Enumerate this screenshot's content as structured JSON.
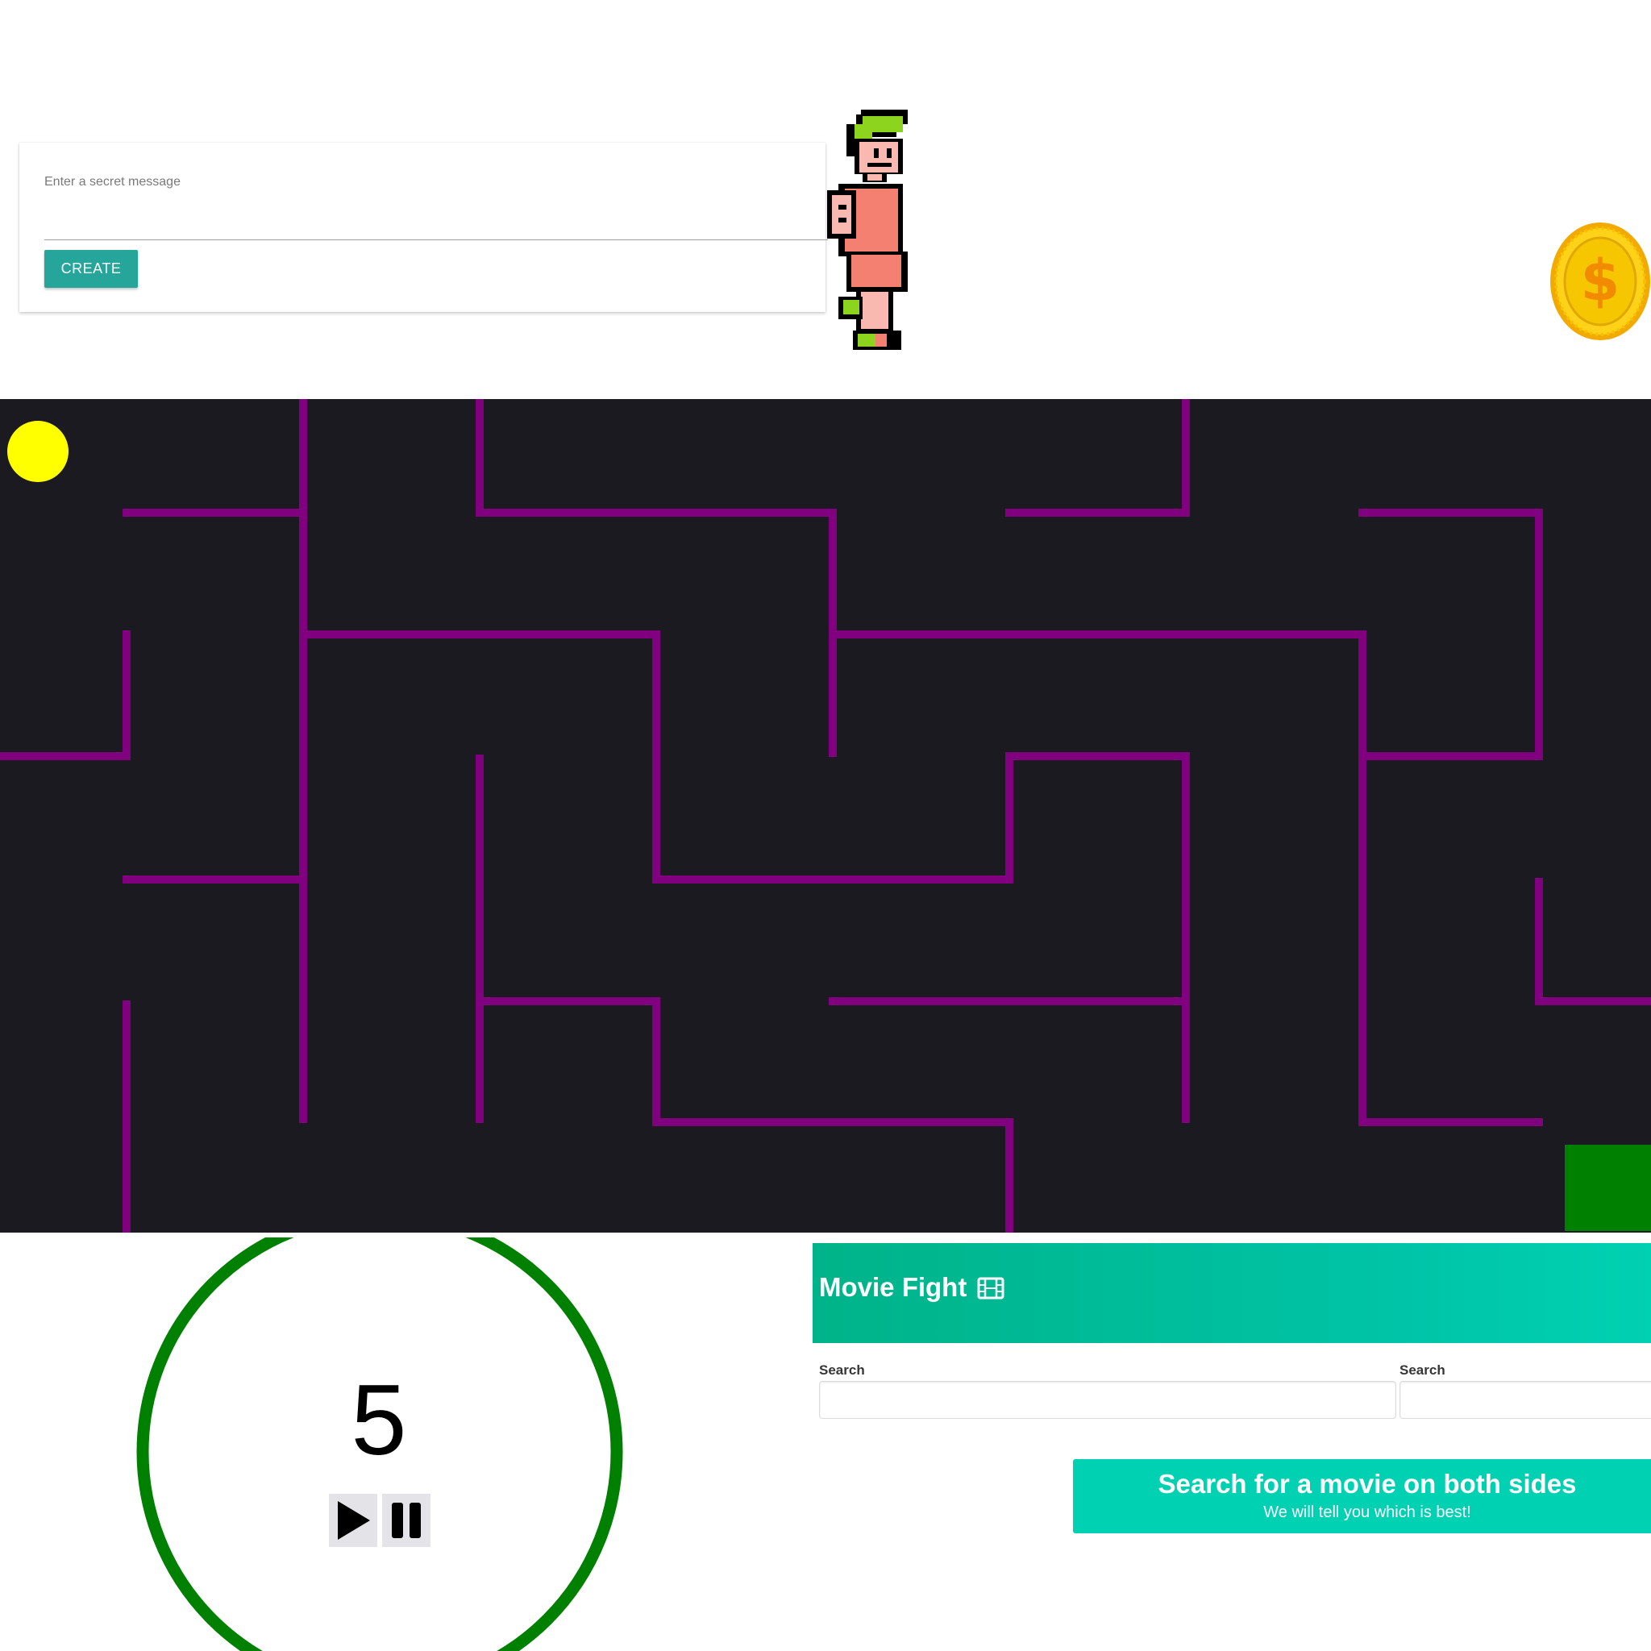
{
  "secret_card": {
    "label": "Enter a secret message",
    "input_value": "",
    "button_label": "CREATE"
  },
  "colors": {
    "accent_teal": "#26a69a",
    "maze_background": "#1a1a20",
    "maze_wall": "#800080",
    "ball": "#ffff00",
    "goal": "#008000",
    "timer_ring": "#008000",
    "movie_header": "#00c4a7",
    "movie_notice": "#00d1b2"
  },
  "sprites": {
    "character": "pixel-character-sprite",
    "coin": "dollar-coin-icon"
  },
  "timer": {
    "value": "5",
    "play_icon": "play-icon",
    "pause_icon": "pause-icon"
  },
  "movie_fight": {
    "title": "Movie Fight",
    "title_icon": "film-icon",
    "left_search_label": "Search",
    "right_search_label": "Search",
    "left_search_value": "",
    "right_search_value": "",
    "notice_title": "Search for a movie on both sides",
    "notice_subtitle": "We will tell you which is best!"
  }
}
